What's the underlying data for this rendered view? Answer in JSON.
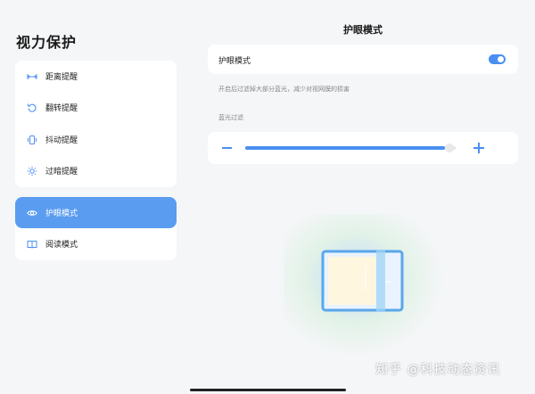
{
  "page_title": "视力保护",
  "sidebar": {
    "group1": [
      {
        "label": "距离提醒",
        "icon": "distance-icon"
      },
      {
        "label": "翻转提醒",
        "icon": "rotate-icon"
      },
      {
        "label": "抖动提醒",
        "icon": "shake-icon"
      },
      {
        "label": "过暗提醒",
        "icon": "brightness-icon"
      }
    ],
    "group2": [
      {
        "label": "护眼模式",
        "icon": "eye-icon",
        "active": true
      },
      {
        "label": "阅读模式",
        "icon": "book-icon"
      }
    ]
  },
  "detail": {
    "title": "护眼模式",
    "toggle_label": "护眼模式",
    "toggle_on": true,
    "description": "开启后过滤掉大部分蓝光，减少对视网膜的损害",
    "filter_label": "蓝光过滤",
    "filter_level_fraction": 0.99
  },
  "watermark": "知乎 @科技动态资讯",
  "colors": {
    "accent": "#4a8ff0",
    "active_bg": "#5a9cf0",
    "background": "#f5f6f8"
  }
}
